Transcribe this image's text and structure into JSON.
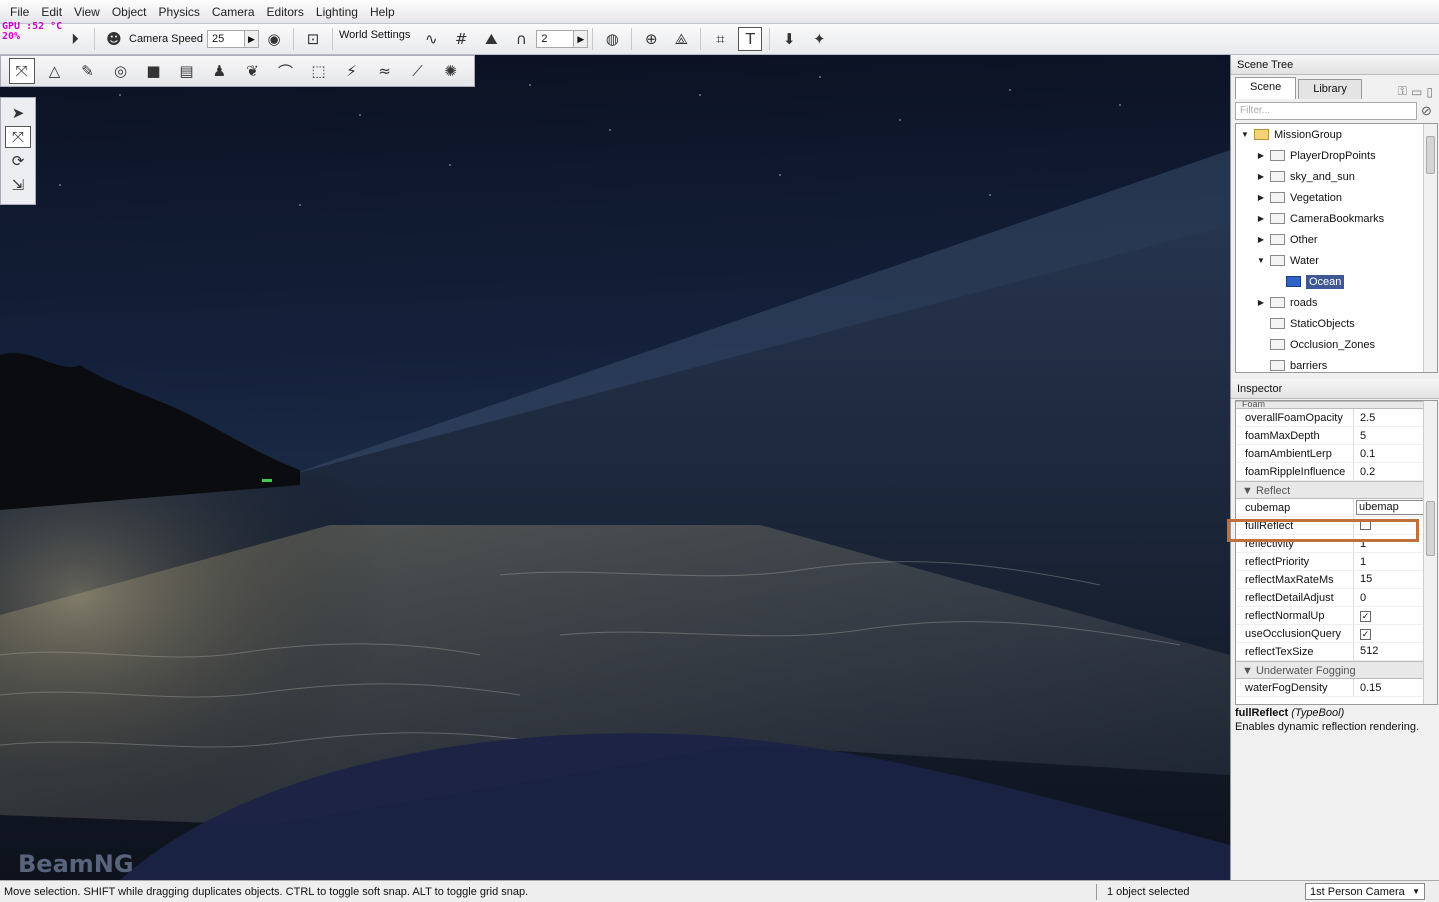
{
  "menu": [
    "File",
    "Edit",
    "View",
    "Object",
    "Physics",
    "Camera",
    "Editors",
    "Lighting",
    "Help"
  ],
  "hud": {
    "line1": "GPU  :52 °C",
    "line2": "20%"
  },
  "toolbar": {
    "camera_speed_label": "Camera Speed",
    "camera_speed_value": "25",
    "world_settings_label": "World Settings",
    "snap_value": "2"
  },
  "viewport": {
    "logo_text": "BeamNG"
  },
  "scene_tree": {
    "title": "Scene Tree",
    "tabs": [
      "Scene",
      "Library"
    ],
    "filter_placeholder": "Filter...",
    "nodes": [
      {
        "label": "MissionGroup",
        "depth": 0,
        "expander": "▼",
        "open": true
      },
      {
        "label": "PlayerDropPoints",
        "depth": 1,
        "expander": "▶"
      },
      {
        "label": "sky_and_sun",
        "depth": 1,
        "expander": "▶"
      },
      {
        "label": "Vegetation",
        "depth": 1,
        "expander": "▶"
      },
      {
        "label": "CameraBookmarks",
        "depth": 1,
        "expander": "▶"
      },
      {
        "label": "Other",
        "depth": 1,
        "expander": "▶"
      },
      {
        "label": "Water",
        "depth": 1,
        "expander": "▼"
      },
      {
        "label": "Ocean",
        "depth": 2,
        "expander": "",
        "selected": true
      },
      {
        "label": "roads",
        "depth": 1,
        "expander": "▶"
      },
      {
        "label": "StaticObjects",
        "depth": 1,
        "expander": ""
      },
      {
        "label": "Occlusion_Zones",
        "depth": 1,
        "expander": ""
      },
      {
        "label": "barriers",
        "depth": 1,
        "expander": ""
      }
    ]
  },
  "inspector": {
    "title": "Inspector",
    "foam_group": "Foam",
    "foam_rows": [
      {
        "key": "overallFoamOpacity",
        "value": "2.5"
      },
      {
        "key": "foamMaxDepth",
        "value": "5"
      },
      {
        "key": "foamAmbientLerp",
        "value": "0.1"
      },
      {
        "key": "foamRippleInfluence",
        "value": "0.2"
      }
    ],
    "reflect_group": "Reflect",
    "cubemap_key": "cubemap",
    "cubemap_value": "ubemap",
    "reflect_rows": [
      {
        "key": "fullReflect",
        "value": "",
        "type": "check",
        "checked": false,
        "highlight": true
      },
      {
        "key": "reflectivity",
        "value": "1"
      },
      {
        "key": "reflectPriority",
        "value": "1"
      },
      {
        "key": "reflectMaxRateMs",
        "value": "15",
        "type": "spin"
      },
      {
        "key": "reflectDetailAdjust",
        "value": "0"
      },
      {
        "key": "reflectNormalUp",
        "value": "",
        "type": "check",
        "checked": true
      },
      {
        "key": "useOcclusionQuery",
        "value": "",
        "type": "check",
        "checked": true
      },
      {
        "key": "reflectTexSize",
        "value": "512",
        "type": "spin"
      }
    ],
    "underwater_group": "Underwater Fogging",
    "underwater_rows": [
      {
        "key": "waterFogDensity",
        "value": "0.15"
      }
    ],
    "desc_name": "fullReflect",
    "desc_type": "(TypeBool)",
    "desc_text": "Enables dynamic reflection rendering."
  },
  "status": {
    "hint": "Move selection.  SHIFT while dragging duplicates objects.  CTRL to toggle soft snap.  ALT to toggle grid snap.",
    "selection": "1 object selected",
    "camera": "1st Person Camera"
  },
  "colors": {
    "highlight_box": "#c0703a",
    "selection": "#3f5894"
  }
}
